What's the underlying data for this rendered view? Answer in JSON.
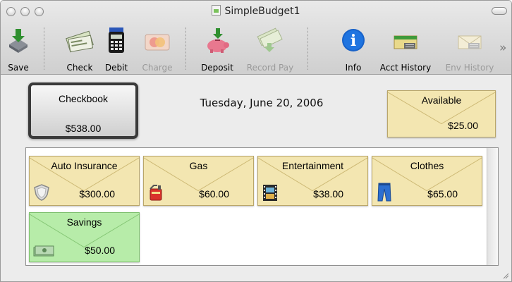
{
  "window": {
    "title": "SimpleBudget1"
  },
  "toolbar": {
    "save": "Save",
    "check": "Check",
    "debit": "Debit",
    "charge": "Charge",
    "deposit": "Deposit",
    "record_pay": "Record Pay",
    "info": "Info",
    "acct_history": "Acct History",
    "env_history": "Env History",
    "overflow": "»"
  },
  "checkbook": {
    "label": "Checkbook",
    "amount": "$538.00"
  },
  "date": "Tuesday, June 20, 2006",
  "available": {
    "label": "Available",
    "amount": "$25.00"
  },
  "envelopes": [
    {
      "name": "Auto Insurance",
      "amount": "$300.00",
      "icon": "shield-icon"
    },
    {
      "name": "Gas",
      "amount": "$60.00",
      "icon": "gas-can-icon"
    },
    {
      "name": "Entertainment",
      "amount": "$38.00",
      "icon": "film-icon"
    },
    {
      "name": "Clothes",
      "amount": "$65.00",
      "icon": "jeans-icon"
    },
    {
      "name": "Savings",
      "amount": "$50.00",
      "icon": "money-icon"
    }
  ],
  "colors": {
    "envelope": "#f3e6b1",
    "envelope_savings": "#b7eca9",
    "checkbook_border": "#3a3a3a"
  }
}
